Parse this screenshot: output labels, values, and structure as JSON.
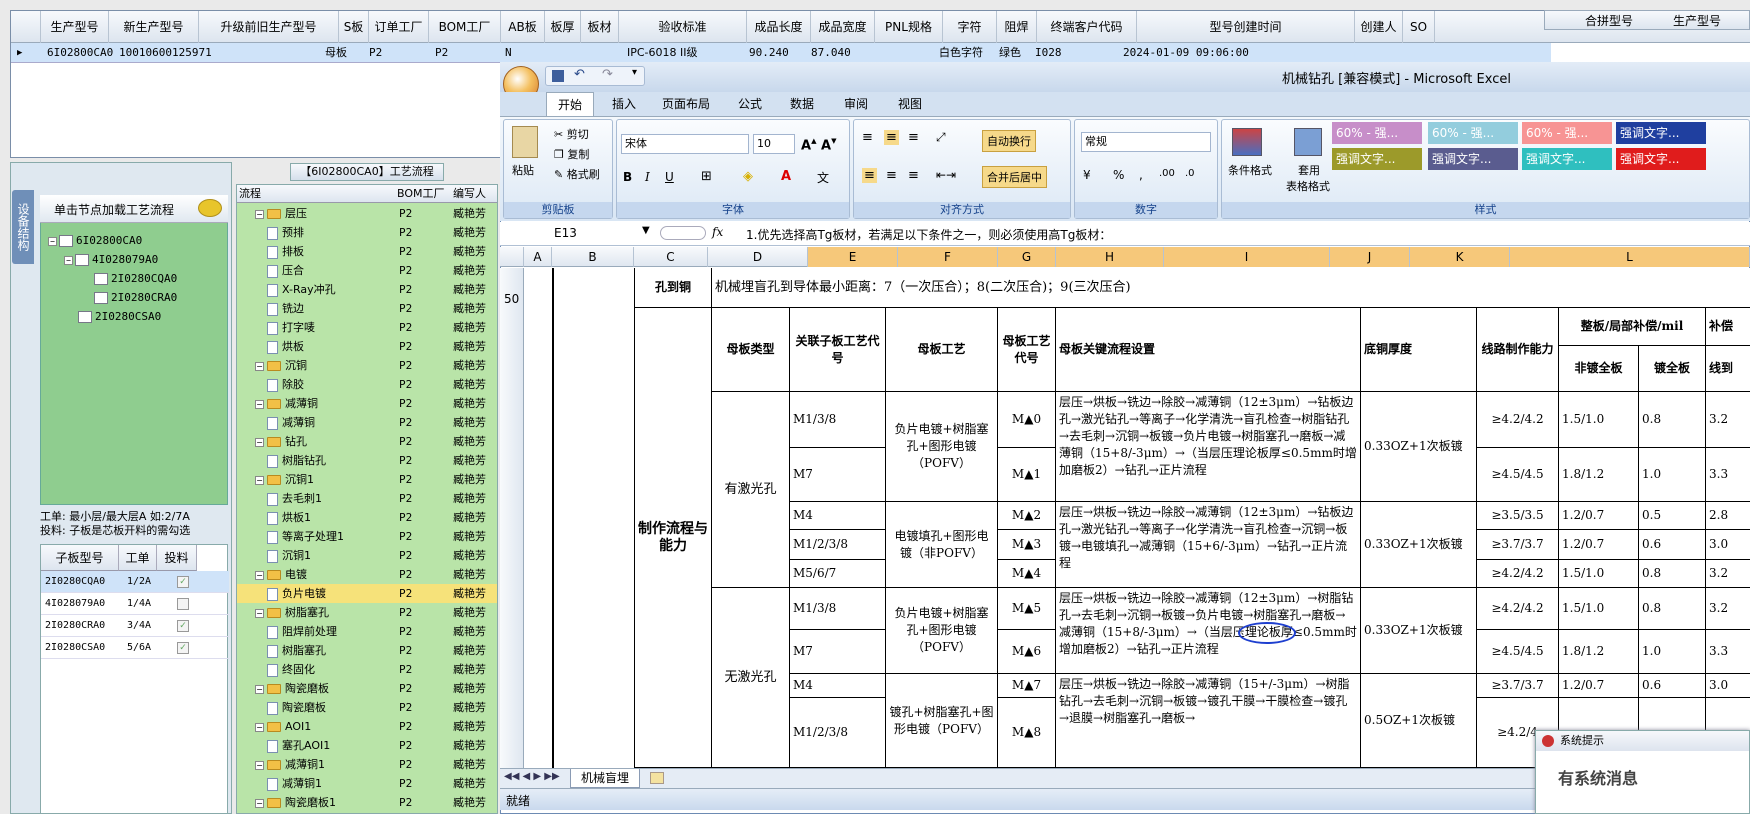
{
  "top_grid": {
    "headers": [
      "生产型号",
      "新生产型号",
      "升级前旧生产型号",
      "S板",
      "订单工厂",
      "BOM工厂",
      "AB板",
      "板厚",
      "板材",
      "验收标准",
      "成品长度",
      "成品宽度",
      "PNL规格",
      "字符",
      "阻焊",
      "终端客户代码",
      "型号创建时间",
      "创建人",
      "SO"
    ],
    "row": {
      "prod_no": "6I02800CA0",
      "new_prod_no": "10010600125971",
      "board_type": "母板",
      "order_factory": "P2",
      "bom_factory": "P2",
      "ab": "N",
      "standard": "IPC-6018 II级",
      "length": "90.240",
      "width": "87.040",
      "silkscreen": "白色字符",
      "soldermask": "绿色",
      "customer": "I028",
      "created": "2024-01-09 09:06:00"
    },
    "side_headers": [
      "合拼型号",
      "生产型号"
    ]
  },
  "left_pane": {
    "vertical_tab": "设备结构",
    "tree_title": "单击节点加载工艺流程",
    "tree": [
      {
        "label": "6I02800CA0",
        "level": 0
      },
      {
        "label": "4I028079A0",
        "level": 1
      },
      {
        "label": "2I0280CQA0",
        "level": 2
      },
      {
        "label": "2I0280CRA0",
        "level": 2
      },
      {
        "label": "2I0280CSA0",
        "level": 1
      }
    ],
    "info_line1": "工单: 最小层/最大层A 如:2/7A",
    "info_line2": "投料: 子板是芯板开料的需勾选",
    "sub_headers": [
      "子板型号",
      "工单",
      "投料"
    ],
    "sub_rows": [
      {
        "model": "2I0280CQA0",
        "order": "1/2A",
        "checked": true
      },
      {
        "model": "4I028079A0",
        "order": "1/4A",
        "checked": false
      },
      {
        "model": "2I0280CRA0",
        "order": "3/4A",
        "checked": true
      },
      {
        "model": "2I0280CSA0",
        "order": "5/6A",
        "checked": true
      }
    ]
  },
  "process": {
    "title": "【6I02800CA0】工艺流程",
    "headers": [
      "流程",
      "BOM工厂",
      "编写人"
    ],
    "rows": [
      {
        "name": "层压",
        "folder": true,
        "level": 1,
        "bom": "P2",
        "author": "臧艳芳"
      },
      {
        "name": "预排",
        "folder": false,
        "level": 2,
        "bom": "P2",
        "author": "臧艳芳"
      },
      {
        "name": "排板",
        "folder": false,
        "level": 2,
        "bom": "P2",
        "author": "臧艳芳"
      },
      {
        "name": "压合",
        "folder": false,
        "level": 2,
        "bom": "P2",
        "author": "臧艳芳"
      },
      {
        "name": "X-Ray冲孔",
        "folder": false,
        "level": 2,
        "bom": "P2",
        "author": "臧艳芳"
      },
      {
        "name": "铣边",
        "folder": false,
        "level": 2,
        "bom": "P2",
        "author": "臧艳芳"
      },
      {
        "name": "打字唛",
        "folder": false,
        "level": 2,
        "bom": "P2",
        "author": "臧艳芳"
      },
      {
        "name": "烘板",
        "folder": false,
        "level": 2,
        "bom": "P2",
        "author": "臧艳芳"
      },
      {
        "name": "沉铜",
        "folder": true,
        "level": 1,
        "bom": "P2",
        "author": "臧艳芳"
      },
      {
        "name": "除胶",
        "folder": false,
        "level": 2,
        "bom": "P2",
        "author": "臧艳芳"
      },
      {
        "name": "减薄铜",
        "folder": true,
        "level": 1,
        "bom": "P2",
        "author": "臧艳芳"
      },
      {
        "name": "减薄铜",
        "folder": false,
        "level": 2,
        "bom": "P2",
        "author": "臧艳芳"
      },
      {
        "name": "钻孔",
        "folder": true,
        "level": 1,
        "bom": "P2",
        "author": "臧艳芳"
      },
      {
        "name": "树脂钻孔",
        "folder": false,
        "level": 2,
        "bom": "P2",
        "author": "臧艳芳"
      },
      {
        "name": "沉铜1",
        "folder": true,
        "level": 1,
        "bom": "P2",
        "author": "臧艳芳"
      },
      {
        "name": "去毛刺1",
        "folder": false,
        "level": 2,
        "bom": "P2",
        "author": "臧艳芳"
      },
      {
        "name": "烘板1",
        "folder": false,
        "level": 2,
        "bom": "P2",
        "author": "臧艳芳"
      },
      {
        "name": "等离子处理1",
        "folder": false,
        "level": 2,
        "bom": "P2",
        "author": "臧艳芳"
      },
      {
        "name": "沉铜1",
        "folder": false,
        "level": 2,
        "bom": "P2",
        "author": "臧艳芳"
      },
      {
        "name": "电镀",
        "folder": true,
        "level": 1,
        "bom": "P2",
        "author": "臧艳芳"
      },
      {
        "name": "负片电镀",
        "folder": false,
        "level": 2,
        "bom": "P2",
        "author": "臧艳芳",
        "selected": true
      },
      {
        "name": "树脂塞孔",
        "folder": true,
        "level": 1,
        "bom": "P2",
        "author": "臧艳芳"
      },
      {
        "name": "阻焊前处理",
        "folder": false,
        "level": 2,
        "bom": "P2",
        "author": "臧艳芳"
      },
      {
        "name": "树脂塞孔",
        "folder": false,
        "level": 2,
        "bom": "P2",
        "author": "臧艳芳"
      },
      {
        "name": "终固化",
        "folder": false,
        "level": 2,
        "bom": "P2",
        "author": "臧艳芳"
      },
      {
        "name": "陶瓷磨板",
        "folder": true,
        "level": 1,
        "bom": "P2",
        "author": "臧艳芳"
      },
      {
        "name": "陶瓷磨板",
        "folder": false,
        "level": 2,
        "bom": "P2",
        "author": "臧艳芳"
      },
      {
        "name": "AOI1",
        "folder": true,
        "level": 1,
        "bom": "P2",
        "author": "臧艳芳"
      },
      {
        "name": "塞孔AOI1",
        "folder": false,
        "level": 2,
        "bom": "P2",
        "author": "臧艳芳"
      },
      {
        "name": "减薄铜1",
        "folder": true,
        "level": 1,
        "bom": "P2",
        "author": "臧艳芳"
      },
      {
        "name": "减薄铜1",
        "folder": false,
        "level": 2,
        "bom": "P2",
        "author": "臧艳芳"
      },
      {
        "name": "陶瓷磨板1",
        "folder": true,
        "level": 1,
        "bom": "P2",
        "author": "臧艳芳"
      }
    ]
  },
  "excel": {
    "title": "机械钻孔  [兼容模式] - Microsoft Excel",
    "tabs": [
      "开始",
      "插入",
      "页面布局",
      "公式",
      "数据",
      "审阅",
      "视图"
    ],
    "clipboard": {
      "paste": "粘贴",
      "cut": "剪切",
      "copy": "复制",
      "format_painter": "格式刷",
      "label": "剪贴板"
    },
    "font": {
      "name": "宋体",
      "size": "10",
      "label": "字体"
    },
    "align": {
      "wrap": "自动换行",
      "merge": "合并后居中",
      "label": "对齐方式"
    },
    "number": {
      "format": "常规",
      "label": "数字"
    },
    "styles": {
      "cond_format": "条件格式",
      "table_format1": "套用",
      "table_format2": "表格格式",
      "label": "样式",
      "boxes": [
        {
          "text": "60% - 强...",
          "color": "#c78ec9"
        },
        {
          "text": "60% - 强...",
          "color": "#93cddd"
        },
        {
          "text": "60% - 强...",
          "color": "#f79494"
        },
        {
          "text": "强调文字...",
          "color": "#1f3f9f"
        },
        {
          "text": "强调文字...",
          "color": "#9c9a2a"
        },
        {
          "text": "强调文字...",
          "color": "#5a5c8f"
        },
        {
          "text": "强调文字...",
          "color": "#2fbfbf"
        },
        {
          "text": "强调文字...",
          "color": "#e01c1c"
        }
      ]
    },
    "name_box": "E13",
    "formula": "1.优先选择高Tg板材，若满足以下条件之一，则必须使用高Tg板材：",
    "columns": [
      "A",
      "B",
      "C",
      "D",
      "E",
      "F",
      "G",
      "H",
      "I",
      "J",
      "K",
      "L"
    ],
    "row_number": "50",
    "sheet_tab": "机械盲埋",
    "status": "就绪",
    "sheet": {
      "hole_copper_label": "孔到铜",
      "hole_copper_text": "机械埋盲孔到导体最小距离：7（一次压合）；8(二次压合)；9(三次压合)",
      "flow_label": "制作流程与能力",
      "h_mother_type": "母板类型",
      "h_related": "关联子板工艺代号",
      "h_process": "母板工艺",
      "h_process_code": "母板工艺代号",
      "h_key_flow": "母板关键流程设置",
      "h_base_cu": "底铜厚度",
      "h_capability": "线路制作能力",
      "h_comp": "整板/局部补偿/mil",
      "h_comp2": "补偿",
      "h_non_plated": "非镀全板",
      "h_plated": "镀全板",
      "h_line": "线到",
      "laser": "有激光孔",
      "no_laser": "无激光孔",
      "rows": [
        {
          "code": "M1/3/8",
          "pcode": "M▲0",
          "cap": "≥4.2/4.2",
          "np": "1.5/1.0",
          "pl": "0.8",
          "ln": "3.2"
        },
        {
          "code": "M7",
          "pcode": "M▲1",
          "cap": "≥4.5/4.5",
          "np": "1.8/1.2",
          "pl": "1.0",
          "ln": "3.3"
        },
        {
          "code": "M4",
          "pcode": "M▲2",
          "cap": "≥3.5/3.5",
          "np": "1.2/0.7",
          "pl": "0.5",
          "ln": "2.8"
        },
        {
          "code": "M1/2/3/8",
          "pcode": "M▲3",
          "cap": "≥3.7/3.7",
          "np": "1.2/0.7",
          "pl": "0.6",
          "ln": "3.0"
        },
        {
          "code": "M5/6/7",
          "pcode": "M▲4",
          "cap": "≥4.2/4.2",
          "np": "1.5/1.0",
          "pl": "0.8",
          "ln": "3.2"
        },
        {
          "code": "M1/3/8",
          "pcode": "M▲5",
          "cap": "≥4.2/4.2",
          "np": "1.5/1.0",
          "pl": "0.8",
          "ln": "3.2"
        },
        {
          "code": "M7",
          "pcode": "M▲6",
          "cap": "≥4.5/4.5",
          "np": "1.8/1.2",
          "pl": "1.0",
          "ln": "3.3"
        },
        {
          "code": "M4",
          "pcode": "M▲7",
          "cap": "≥3.7/3.7",
          "np": "1.2/0.7",
          "pl": "0.6",
          "ln": "3.0"
        },
        {
          "code": "M1/2/3/8",
          "pcode": "M▲8",
          "cap": "≥4.2/4",
          "np": "",
          "pl": "",
          "ln": ""
        }
      ],
      "proc1": "负片电镀+树脂塞孔+图形电镀（POFV）",
      "proc2": "电镀填孔+图形电镀（非POFV）",
      "proc3": "负片电镀+树脂塞孔+图形电镀（POFV）",
      "proc4": "镀孔+树脂塞孔+图形电镀（POFV）",
      "flow1": "层压→烘板→铣边→除胶→减薄铜（12±3μm）→钻板边孔→激光钻孔→等离子→化学清洗→盲孔检查→树脂钻孔→去毛刺→沉铜→板镀→负片电镀→树脂塞孔→磨板→减薄铜（15+8/-3μm）→（当层压理论板厚≤0.5mm时增加磨板2）→钻孔→正片流程",
      "flow2": "层压→烘板→铣边→除胶→减薄铜（12±3μm）→钻板边孔→激光钻孔→等离子→化学清洗→盲孔检查→沉铜→板镀→电镀填孔→减薄铜（15+6/-3μm）→钻孔→正片流程",
      "flow3": "层压→烘板→铣边→除胶→减薄铜（12±3μm）→树脂钻孔→去毛刺→沉铜→板镀→负片电镀→树脂塞孔→磨板→减薄铜（15+8/-3μm）→（当层压理论板厚≤0.5mm时增加磨板2）→钻孔→正片流程",
      "flow4": "层压→烘板→铣边→除胶→减薄铜（15+/-3μm）→树脂钻孔→去毛刺→沉铜→板镀→镀孔干膜→干膜检查→镀孔→退膜→树脂塞孔→磨板→",
      "cu1": "0.33OZ+1次板镀",
      "cu2": "0.33OZ+1次板镀",
      "cu3": "0.33OZ+1次板镀",
      "cu4": "0.5OZ+1次板镀"
    }
  },
  "popup": {
    "title": "系统提示",
    "message": "有系统消息"
  }
}
